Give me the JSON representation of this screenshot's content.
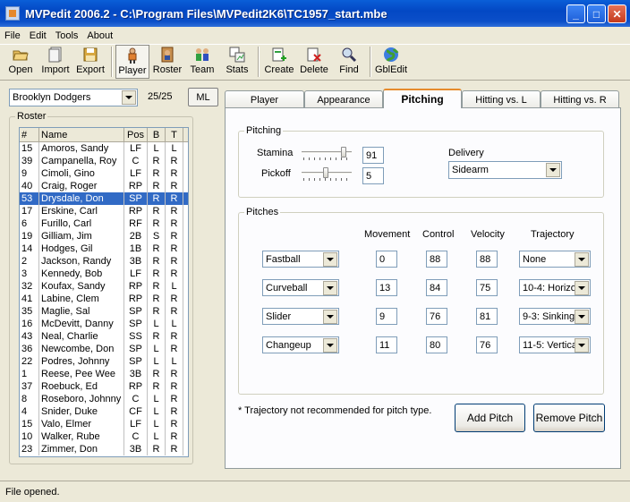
{
  "window": {
    "title": "MVPedit 2006.2 - C:\\Program Files\\MVPedit2K6\\TC1957_start.mbe",
    "minimize": "_",
    "maximize": "□",
    "close": "✕"
  },
  "menu": [
    "File",
    "Edit",
    "Tools",
    "About"
  ],
  "toolbar": [
    {
      "label": "Open",
      "icon": "open-folder-icon"
    },
    {
      "label": "Import",
      "icon": "import-page-icon"
    },
    {
      "label": "Export",
      "icon": "export-floppy-icon"
    },
    {
      "label": "Player",
      "icon": "player-icon"
    },
    {
      "label": "Roster",
      "icon": "roster-icon"
    },
    {
      "label": "Team",
      "icon": "team-icon"
    },
    {
      "label": "Stats",
      "icon": "stats-icon"
    },
    {
      "label": "Create",
      "icon": "create-icon"
    },
    {
      "label": "Delete",
      "icon": "delete-icon"
    },
    {
      "label": "Find",
      "icon": "find-icon"
    },
    {
      "label": "GblEdit",
      "icon": "globe-icon"
    }
  ],
  "team": {
    "selected": "Brooklyn Dodgers",
    "count": "25/25",
    "ml_label": "ML"
  },
  "roster": {
    "legend": "Roster",
    "headers": [
      "#",
      "Name",
      "Pos",
      "B",
      "T"
    ],
    "rows": [
      [
        "15",
        "Amoros, Sandy",
        "LF",
        "L",
        "L"
      ],
      [
        "39",
        "Campanella, Roy",
        "C",
        "R",
        "R"
      ],
      [
        "9",
        "Cimoli, Gino",
        "LF",
        "R",
        "R"
      ],
      [
        "40",
        "Craig, Roger",
        "RP",
        "R",
        "R"
      ],
      [
        "53",
        "Drysdale, Don",
        "SP",
        "R",
        "R"
      ],
      [
        "17",
        "Erskine, Carl",
        "RP",
        "R",
        "R"
      ],
      [
        "6",
        "Furillo, Carl",
        "RF",
        "R",
        "R"
      ],
      [
        "19",
        "Gilliam, Jim",
        "2B",
        "S",
        "R"
      ],
      [
        "14",
        "Hodges, Gil",
        "1B",
        "R",
        "R"
      ],
      [
        "2",
        "Jackson, Randy",
        "3B",
        "R",
        "R"
      ],
      [
        "3",
        "Kennedy, Bob",
        "LF",
        "R",
        "R"
      ],
      [
        "32",
        "Koufax, Sandy",
        "RP",
        "R",
        "L"
      ],
      [
        "41",
        "Labine, Clem",
        "RP",
        "R",
        "R"
      ],
      [
        "35",
        "Maglie, Sal",
        "SP",
        "R",
        "R"
      ],
      [
        "16",
        "McDevitt, Danny",
        "SP",
        "L",
        "L"
      ],
      [
        "43",
        "Neal, Charlie",
        "SS",
        "R",
        "R"
      ],
      [
        "36",
        "Newcombe, Don",
        "SP",
        "L",
        "R"
      ],
      [
        "22",
        "Podres, Johnny",
        "SP",
        "L",
        "L"
      ],
      [
        "1",
        "Reese, Pee Wee",
        "3B",
        "R",
        "R"
      ],
      [
        "37",
        "Roebuck, Ed",
        "RP",
        "R",
        "R"
      ],
      [
        "8",
        "Roseboro, Johnny",
        "C",
        "L",
        "R"
      ],
      [
        "4",
        "Snider, Duke",
        "CF",
        "L",
        "R"
      ],
      [
        "15",
        "Valo, Elmer",
        "LF",
        "L",
        "R"
      ],
      [
        "10",
        "Walker, Rube",
        "C",
        "L",
        "R"
      ],
      [
        "23",
        "Zimmer, Don",
        "3B",
        "R",
        "R"
      ]
    ],
    "selected_index": 4
  },
  "tabs": [
    "Player",
    "Appearance",
    "Pitching",
    "Hitting vs. L",
    "Hitting vs. R"
  ],
  "active_tab": "Pitching",
  "pitching": {
    "legend": "Pitching",
    "stamina_label": "Stamina",
    "stamina_value": "91",
    "stamina_level": 0.91,
    "pickoff_label": "Pickoff",
    "pickoff_value": "5",
    "pickoff_level": 0.5,
    "delivery_label": "Delivery",
    "delivery_value": "Sidearm"
  },
  "pitches": {
    "legend": "Pitches",
    "headers": [
      "Movement",
      "Control",
      "Velocity",
      "Trajectory"
    ],
    "rows": [
      {
        "name": "Fastball",
        "movement": "0",
        "control": "88",
        "velocity": "88",
        "trajectory": "None"
      },
      {
        "name": "Curveball",
        "movement": "13",
        "control": "84",
        "velocity": "75",
        "trajectory": "10-4: Horizo"
      },
      {
        "name": "Slider",
        "movement": "9",
        "control": "76",
        "velocity": "81",
        "trajectory": "9-3: Sinking"
      },
      {
        "name": "Changeup",
        "movement": "11",
        "control": "80",
        "velocity": "76",
        "trajectory": "11-5: Vertica"
      }
    ]
  },
  "note": "* Trajectory not recommended for pitch type.",
  "buttons": {
    "add_pitch": "Add Pitch",
    "remove_pitch": "Remove Pitch"
  },
  "status": "File opened."
}
